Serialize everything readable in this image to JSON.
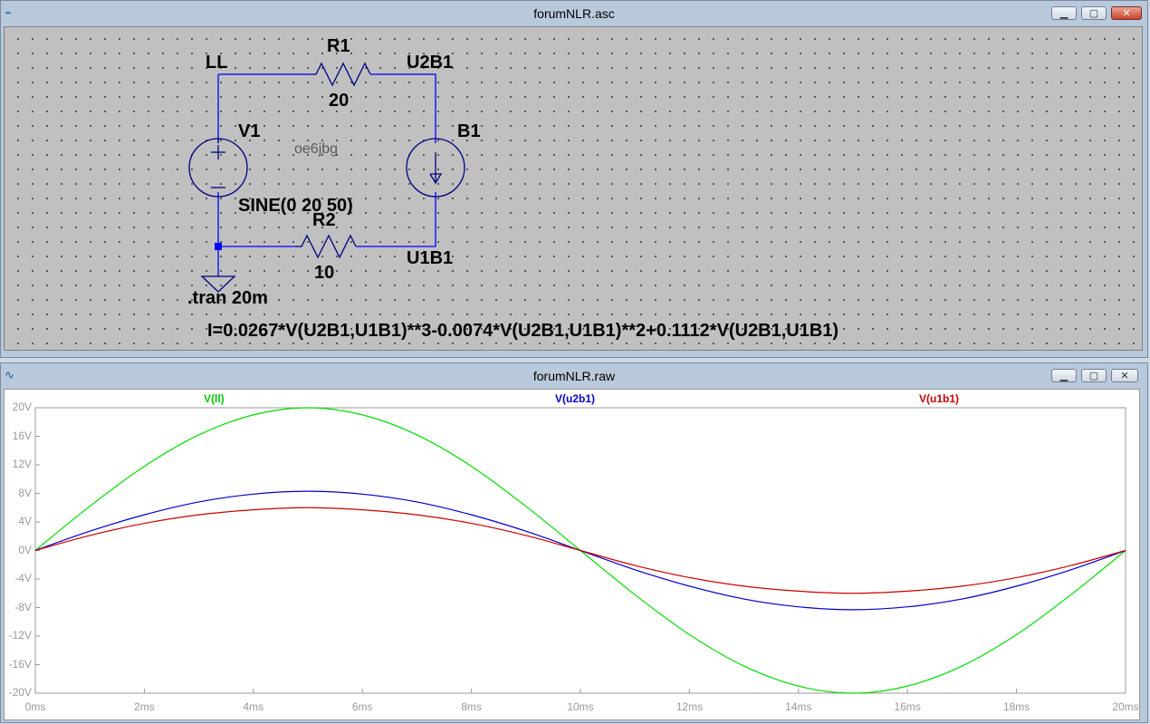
{
  "schematic_window": {
    "title": "forumNLR.asc",
    "app_icon": "ltspice-icon",
    "controls": {
      "minimize": "▁",
      "maximize": "▢",
      "close": "✕"
    }
  },
  "schematic": {
    "nodes": {
      "ll": "LL",
      "u2b1": "U2B1",
      "u1b1": "U1B1"
    },
    "r1": {
      "name": "R1",
      "value": "20"
    },
    "r2": {
      "name": "R2",
      "value": "10"
    },
    "v1": {
      "name": "V1",
      "value": "SINE(0 20 50)"
    },
    "b1": {
      "name": "B1"
    },
    "watermark": "oe6jbg",
    "directive": ".tran 20m",
    "b1_expression": "I=0.0267*V(U2B1,U1B1)**3-0.0074*V(U2B1,U1B1)**2+0.1112*V(U2B1,U1B1)",
    "wire_color": "#0000ff",
    "symbol_color": "#000080"
  },
  "plot_window": {
    "title": "forumNLR.raw",
    "app_icon": "waveform-icon",
    "controls": {
      "minimize": "▁",
      "maximize": "▢",
      "close": "✕"
    }
  },
  "chart_data": {
    "type": "line",
    "title": "",
    "xlabel": "",
    "ylabel": "",
    "xlim": [
      0,
      20
    ],
    "ylim": [
      -20,
      20
    ],
    "x_ticks": [
      "0ms",
      "2ms",
      "4ms",
      "6ms",
      "8ms",
      "10ms",
      "12ms",
      "14ms",
      "16ms",
      "18ms",
      "20ms"
    ],
    "y_ticks": [
      "20V",
      "16V",
      "12V",
      "8V",
      "4V",
      "0V",
      "-4V",
      "-8V",
      "-12V",
      "-16V",
      "-20V"
    ],
    "grid": false,
    "legend_placement": "top",
    "x": [
      0,
      1,
      2,
      3,
      4,
      5,
      6,
      7,
      8,
      9,
      10,
      11,
      12,
      13,
      14,
      15,
      16,
      17,
      18,
      19,
      20
    ],
    "series": [
      {
        "name": "V(ll)",
        "color": "#00dd00",
        "values": [
          0,
          6.2,
          11.8,
          16.2,
          19.0,
          20.0,
          19.0,
          16.2,
          11.8,
          6.2,
          0,
          -6.2,
          -11.8,
          -16.2,
          -19.0,
          -20.0,
          -19.0,
          -16.2,
          -11.8,
          -6.2,
          0
        ]
      },
      {
        "name": "V(u2b1)",
        "color": "#0000cc",
        "values": [
          0,
          2.7,
          5.0,
          6.8,
          7.9,
          8.3,
          7.9,
          6.8,
          5.0,
          2.7,
          0,
          -2.7,
          -5.0,
          -6.8,
          -7.9,
          -8.3,
          -7.9,
          -6.8,
          -5.0,
          -2.7,
          0
        ]
      },
      {
        "name": "V(u1b1)",
        "color": "#cc0000",
        "values": [
          0,
          2.1,
          3.8,
          5.0,
          5.7,
          6.0,
          5.7,
          5.0,
          3.8,
          2.1,
          0,
          -2.1,
          -3.8,
          -5.0,
          -5.7,
          -6.0,
          -5.7,
          -5.0,
          -3.8,
          -2.1,
          0
        ]
      }
    ]
  }
}
